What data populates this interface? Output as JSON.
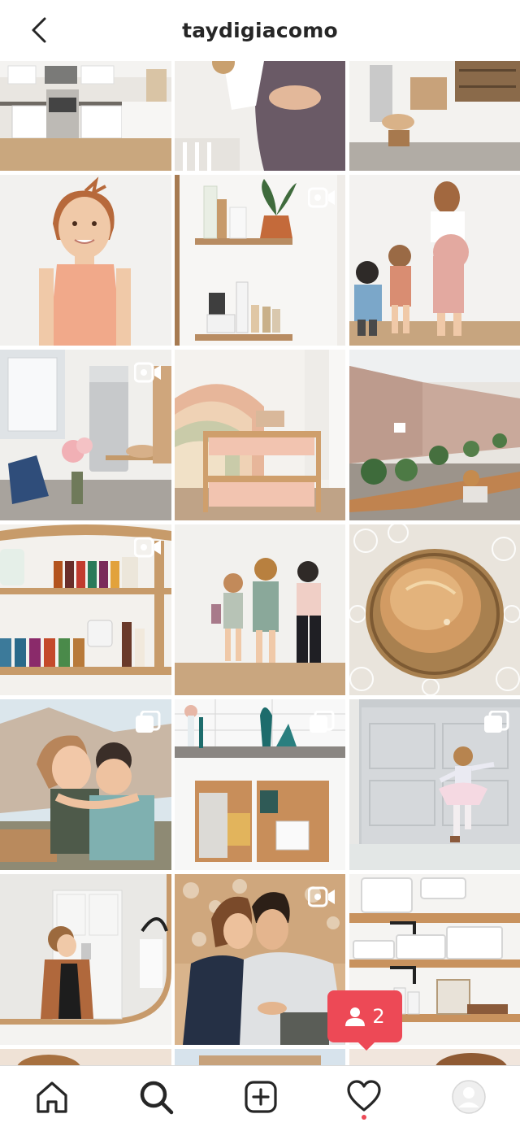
{
  "header": {
    "username": "taydigiacomo",
    "back_icon": "chevron-left-icon"
  },
  "grid": {
    "badge_icons": {
      "video": "video-camera-icon",
      "carousel": "multiple-photos-icon"
    }
  },
  "notification": {
    "icon": "person-icon",
    "count": "2",
    "color": "#ed4956"
  },
  "tabbar": {
    "items": [
      {
        "icon": "home-icon"
      },
      {
        "icon": "search-icon",
        "active": true
      },
      {
        "icon": "add-post-icon"
      },
      {
        "icon": "heart-icon",
        "has_dot": true
      },
      {
        "icon": "profile-avatar-icon"
      }
    ]
  },
  "colors": {
    "text": "#262626",
    "accent": "#ed4956"
  }
}
